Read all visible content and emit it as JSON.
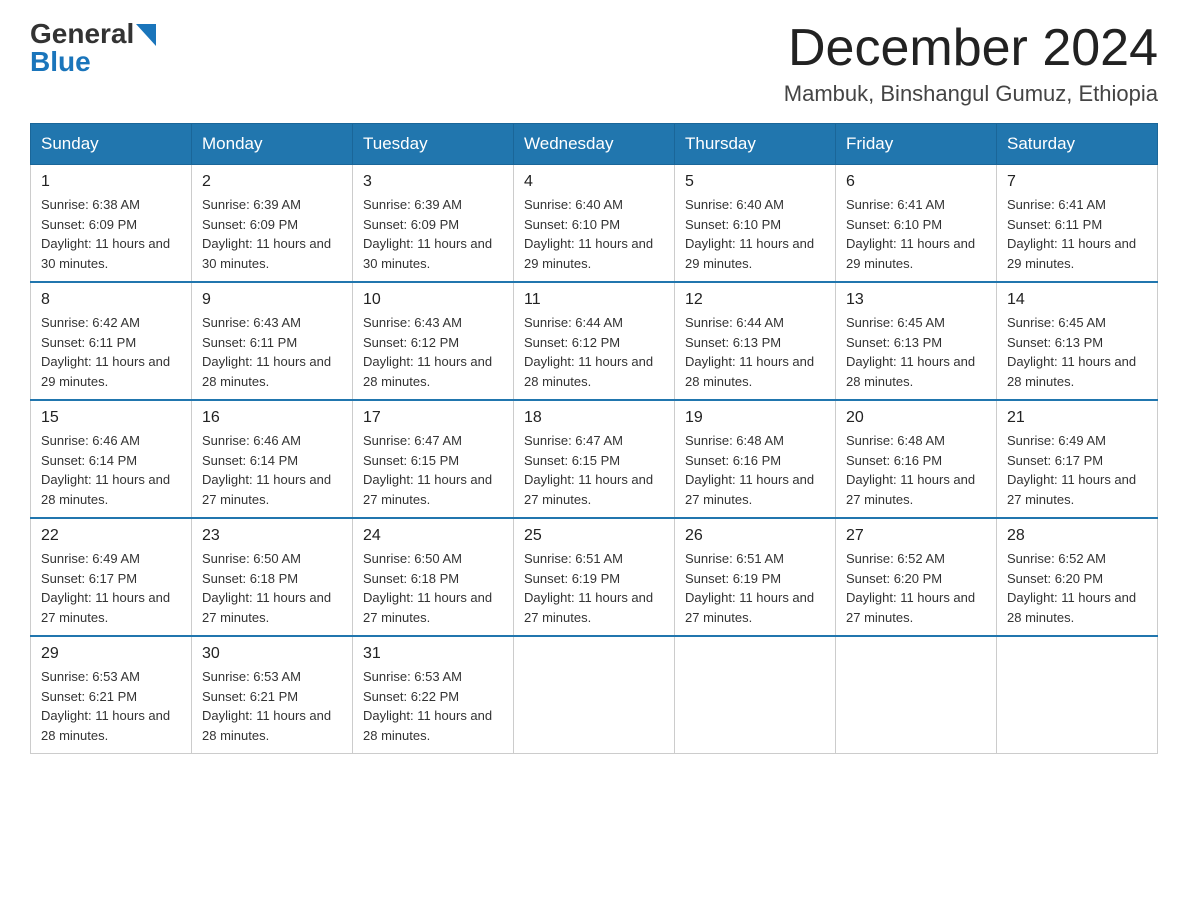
{
  "logo": {
    "general": "General",
    "blue": "Blue"
  },
  "title": "December 2024",
  "location": "Mambuk, Binshangul Gumuz, Ethiopia",
  "weekdays": [
    "Sunday",
    "Monday",
    "Tuesday",
    "Wednesday",
    "Thursday",
    "Friday",
    "Saturday"
  ],
  "weeks": [
    [
      {
        "day": "1",
        "sunrise": "6:38 AM",
        "sunset": "6:09 PM",
        "daylight": "11 hours and 30 minutes."
      },
      {
        "day": "2",
        "sunrise": "6:39 AM",
        "sunset": "6:09 PM",
        "daylight": "11 hours and 30 minutes."
      },
      {
        "day": "3",
        "sunrise": "6:39 AM",
        "sunset": "6:09 PM",
        "daylight": "11 hours and 30 minutes."
      },
      {
        "day": "4",
        "sunrise": "6:40 AM",
        "sunset": "6:10 PM",
        "daylight": "11 hours and 29 minutes."
      },
      {
        "day": "5",
        "sunrise": "6:40 AM",
        "sunset": "6:10 PM",
        "daylight": "11 hours and 29 minutes."
      },
      {
        "day": "6",
        "sunrise": "6:41 AM",
        "sunset": "6:10 PM",
        "daylight": "11 hours and 29 minutes."
      },
      {
        "day": "7",
        "sunrise": "6:41 AM",
        "sunset": "6:11 PM",
        "daylight": "11 hours and 29 minutes."
      }
    ],
    [
      {
        "day": "8",
        "sunrise": "6:42 AM",
        "sunset": "6:11 PM",
        "daylight": "11 hours and 29 minutes."
      },
      {
        "day": "9",
        "sunrise": "6:43 AM",
        "sunset": "6:11 PM",
        "daylight": "11 hours and 28 minutes."
      },
      {
        "day": "10",
        "sunrise": "6:43 AM",
        "sunset": "6:12 PM",
        "daylight": "11 hours and 28 minutes."
      },
      {
        "day": "11",
        "sunrise": "6:44 AM",
        "sunset": "6:12 PM",
        "daylight": "11 hours and 28 minutes."
      },
      {
        "day": "12",
        "sunrise": "6:44 AM",
        "sunset": "6:13 PM",
        "daylight": "11 hours and 28 minutes."
      },
      {
        "day": "13",
        "sunrise": "6:45 AM",
        "sunset": "6:13 PM",
        "daylight": "11 hours and 28 minutes."
      },
      {
        "day": "14",
        "sunrise": "6:45 AM",
        "sunset": "6:13 PM",
        "daylight": "11 hours and 28 minutes."
      }
    ],
    [
      {
        "day": "15",
        "sunrise": "6:46 AM",
        "sunset": "6:14 PM",
        "daylight": "11 hours and 28 minutes."
      },
      {
        "day": "16",
        "sunrise": "6:46 AM",
        "sunset": "6:14 PM",
        "daylight": "11 hours and 27 minutes."
      },
      {
        "day": "17",
        "sunrise": "6:47 AM",
        "sunset": "6:15 PM",
        "daylight": "11 hours and 27 minutes."
      },
      {
        "day": "18",
        "sunrise": "6:47 AM",
        "sunset": "6:15 PM",
        "daylight": "11 hours and 27 minutes."
      },
      {
        "day": "19",
        "sunrise": "6:48 AM",
        "sunset": "6:16 PM",
        "daylight": "11 hours and 27 minutes."
      },
      {
        "day": "20",
        "sunrise": "6:48 AM",
        "sunset": "6:16 PM",
        "daylight": "11 hours and 27 minutes."
      },
      {
        "day": "21",
        "sunrise": "6:49 AM",
        "sunset": "6:17 PM",
        "daylight": "11 hours and 27 minutes."
      }
    ],
    [
      {
        "day": "22",
        "sunrise": "6:49 AM",
        "sunset": "6:17 PM",
        "daylight": "11 hours and 27 minutes."
      },
      {
        "day": "23",
        "sunrise": "6:50 AM",
        "sunset": "6:18 PM",
        "daylight": "11 hours and 27 minutes."
      },
      {
        "day": "24",
        "sunrise": "6:50 AM",
        "sunset": "6:18 PM",
        "daylight": "11 hours and 27 minutes."
      },
      {
        "day": "25",
        "sunrise": "6:51 AM",
        "sunset": "6:19 PM",
        "daylight": "11 hours and 27 minutes."
      },
      {
        "day": "26",
        "sunrise": "6:51 AM",
        "sunset": "6:19 PM",
        "daylight": "11 hours and 27 minutes."
      },
      {
        "day": "27",
        "sunrise": "6:52 AM",
        "sunset": "6:20 PM",
        "daylight": "11 hours and 27 minutes."
      },
      {
        "day": "28",
        "sunrise": "6:52 AM",
        "sunset": "6:20 PM",
        "daylight": "11 hours and 28 minutes."
      }
    ],
    [
      {
        "day": "29",
        "sunrise": "6:53 AM",
        "sunset": "6:21 PM",
        "daylight": "11 hours and 28 minutes."
      },
      {
        "day": "30",
        "sunrise": "6:53 AM",
        "sunset": "6:21 PM",
        "daylight": "11 hours and 28 minutes."
      },
      {
        "day": "31",
        "sunrise": "6:53 AM",
        "sunset": "6:22 PM",
        "daylight": "11 hours and 28 minutes."
      },
      null,
      null,
      null,
      null
    ]
  ]
}
